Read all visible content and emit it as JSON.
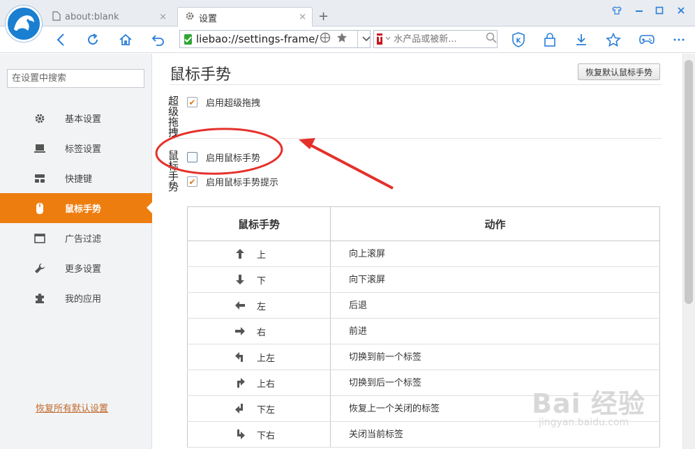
{
  "tabs": [
    {
      "title": "about:blank",
      "icon": "page-icon",
      "close": "×"
    },
    {
      "title": "设置",
      "icon": "gear-icon",
      "close": "×"
    }
  ],
  "new_tab_label": "+",
  "address": {
    "url": "liebao://settings-frame/"
  },
  "search": {
    "placeholder": "水产品或被新..."
  },
  "search_engine_label": "T",
  "sidebar": {
    "search_placeholder": "在设置中搜索",
    "items": [
      {
        "label": "基本设置",
        "icon": "gear-icon"
      },
      {
        "label": "标签设置",
        "icon": "laptop-icon"
      },
      {
        "label": "快捷键",
        "icon": "keyboard-icon"
      },
      {
        "label": "鼠标手势",
        "icon": "mouse-icon",
        "active": true
      },
      {
        "label": "广告过滤",
        "icon": "window-icon"
      },
      {
        "label": "更多设置",
        "icon": "wrench-icon"
      },
      {
        "label": "我的应用",
        "icon": "puzzle-icon"
      }
    ],
    "restore_all": "恢复所有默认设置"
  },
  "main": {
    "title": "鼠标手势",
    "restore_button": "恢复默认鼠标手势",
    "section_drag": "超级拖拽",
    "section_gesture": "鼠标手势",
    "options": [
      {
        "label": "启用超级拖拽",
        "checked": true
      },
      {
        "label": "启用鼠标手势",
        "checked": false
      },
      {
        "label": "启用鼠标手势提示",
        "checked": true
      }
    ],
    "check_mark": "✔",
    "table": {
      "headers": [
        "鼠标手势",
        "动作"
      ],
      "rows": [
        {
          "arrow": "↑",
          "dir": "上",
          "action": "向上滚屏"
        },
        {
          "arrow": "↓",
          "dir": "下",
          "action": "向下滚屏"
        },
        {
          "arrow": "←",
          "dir": "左",
          "action": "后退"
        },
        {
          "arrow": "→",
          "dir": "右",
          "action": "前进"
        },
        {
          "arrow": "↰",
          "dir": "上左",
          "action": "切换到前一个标签"
        },
        {
          "arrow": "↱",
          "dir": "上右",
          "action": "切换到后一个标签"
        },
        {
          "arrow": "↵",
          "dir": "下左",
          "action": "恢复上一个关闭的标签"
        },
        {
          "arrow": "↳",
          "dir": "下右",
          "action": "关闭当前标签"
        }
      ]
    }
  },
  "watermark": {
    "text": "Bai 经验",
    "sub": "jingyan.baidu.com"
  },
  "colors": {
    "accent": "#ee7d10",
    "brand_blue": "#2a7fd8",
    "annotation_red": "#e5302a"
  }
}
